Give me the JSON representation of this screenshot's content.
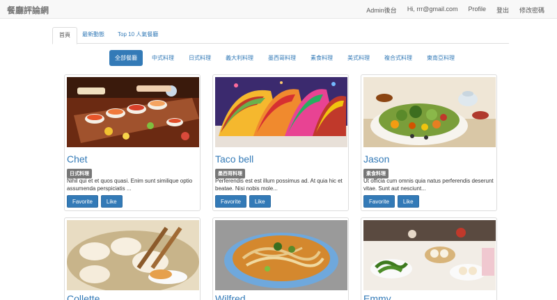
{
  "navbar": {
    "brand": "餐廳評論網",
    "links": [
      "Admin後台",
      "Hi, rrr@gmail.com",
      "Profile",
      "登出",
      "修改密碼"
    ]
  },
  "tabs": [
    "首頁",
    "最新動態",
    "Top 10 人氣餐廳"
  ],
  "categories": [
    "全部餐廳",
    "中式料理",
    "日式料理",
    "義大利料理",
    "墨西哥料理",
    "素食料理",
    "美式料理",
    "複合式料理",
    "東南亞料理"
  ],
  "buttons": {
    "favorite": "Favorite",
    "like": "Like"
  },
  "restaurants": [
    {
      "name": "Chet",
      "category": "日式料理",
      "description": "Nihil qui et et quos quasi. Enim sunt similique optio assumenda perspiciatis ..."
    },
    {
      "name": "Taco bell",
      "category": "墨西哥料理",
      "description": "Perferendis est est illum possimus ad. At quia hic et beatae. Nisi nobis mole..."
    },
    {
      "name": "Jason",
      "category": "素食料理",
      "description": "Ut officia cum omnis quia natus perferendis deserunt vitae. Sunt aut nesciunt..."
    },
    {
      "name": "Collette",
      "image": "dumplings"
    },
    {
      "name": "Wilfred",
      "image": "noodle-soup"
    },
    {
      "name": "Emmy",
      "image": "dim-sum"
    }
  ],
  "colors": {
    "primary": "#337ab7",
    "badge": "#777777",
    "navbar": "#f8f8f8"
  }
}
